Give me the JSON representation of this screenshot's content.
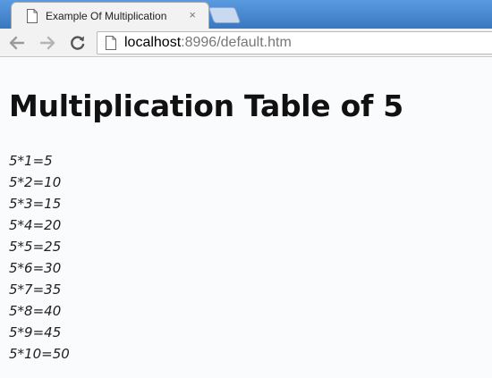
{
  "browser": {
    "tab_title": "Example Of Multiplication",
    "tab_close": "×",
    "url_host": "localhost",
    "url_rest": ":8996/default.htm"
  },
  "page": {
    "title": "Multiplication Table of 5",
    "lines": [
      "5*1=5",
      "5*2=10",
      "5*3=15",
      "5*4=20",
      "5*5=25",
      "5*6=30",
      "5*7=35",
      "5*8=40",
      "5*9=45",
      "5*10=50"
    ]
  }
}
